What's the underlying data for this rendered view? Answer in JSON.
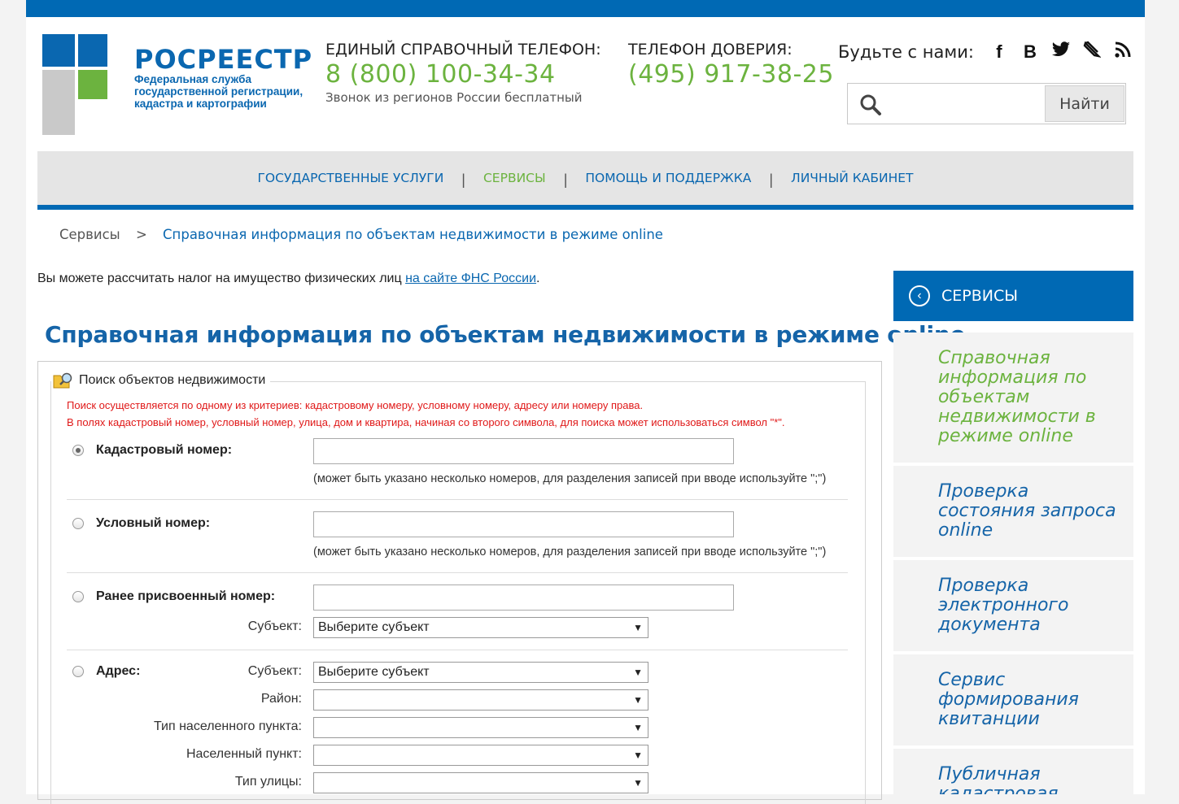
{
  "header": {
    "logo_title": "РОСРЕЕСТР",
    "logo_subtitle": "Федеральная служба государственной регистрации, кадастра и картографии",
    "phone1_label": "ЕДИНЫЙ СПРАВОЧНЫЙ ТЕЛЕФОН:",
    "phone1_number": "8 (800) 100-34-34",
    "phone1_note": "Звонок из регионов России бесплатный",
    "phone2_label": "ТЕЛЕФОН ДОВЕРИЯ:",
    "phone2_number": "(495) 917-38-25",
    "social_label": "Будьте с нами:",
    "social_icons": [
      "facebook-icon",
      "vkontakte-icon",
      "twitter-icon",
      "livejournal-icon",
      "rss-icon"
    ],
    "search_placeholder": "",
    "search_button": "Найти"
  },
  "nav": {
    "items": [
      {
        "label": "ГОСУДАРСТВЕННЫЕ УСЛУГИ",
        "active": false
      },
      {
        "label": "СЕРВИСЫ",
        "active": true
      },
      {
        "label": "ПОМОЩЬ И ПОДДЕРЖКА",
        "active": false
      },
      {
        "label": "ЛИЧНЫЙ КАБИНЕТ",
        "active": false
      }
    ],
    "separator": "|"
  },
  "breadcrumb": {
    "home": "Сервисы",
    "separator": ">",
    "current": "Справочная информация по объектам недвижимости в режиме online"
  },
  "notice": {
    "text": "Вы можете рассчитать налог на имущество физических лиц ",
    "link": "на сайте ФНС России",
    "end": "."
  },
  "page_title": "Справочная информация по объектам недвижимости в режиме online",
  "form": {
    "legend": "Поиск объектов недвижимости",
    "hint1": "Поиск осуществляется по одному из критериев: кадастровому номеру, условному номеру, адресу или номеру права.",
    "hint2": "В полях кадастровый номер, условный номер, улица, дом и квартира, начиная со второго символа, для поиска может использоваться символ \"*\".",
    "cadastral_label": "Кадастровый номер:",
    "cadastral_hint": "(может быть указано несколько номеров, для разделения записей при вводе используйте \";\")",
    "conditional_label": "Условный номер:",
    "conditional_hint": "(может быть указано несколько номеров, для разделения записей при вводе используйте \";\")",
    "previous_label": "Ранее присвоенный номер:",
    "subject_label": "Субъект:",
    "subject_placeholder": "Выберите субъект",
    "address_label": "Адрес:",
    "address_subject_label": "Субъект:",
    "address_subject_value": "Выберите субъект",
    "district_label": "Район:",
    "settlement_type_label": "Тип населенного пункта:",
    "settlement_label": "Населенный пункт:",
    "street_type_label": "Тип улицы:",
    "selected_option": "cadastral"
  },
  "sidebar": {
    "title": "СЕРВИСЫ",
    "items": [
      {
        "label": "Справочная информация по объектам недвижимости в режиме online",
        "active": true
      },
      {
        "label": "Проверка состояния запроса online",
        "active": false
      },
      {
        "label": "Проверка электронного документа",
        "active": false
      },
      {
        "label": "Сервис формирования квитанции",
        "active": false
      },
      {
        "label": "Публичная кадастровая карта",
        "active": false
      }
    ]
  },
  "colors": {
    "brand_blue": "#0069b4",
    "accent_green": "#6cb33f",
    "hint_red": "#e01919"
  }
}
